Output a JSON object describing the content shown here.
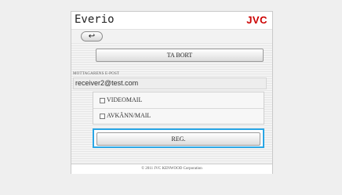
{
  "header": {
    "brand": "Everio",
    "logo": "JVC"
  },
  "nav": {
    "back_icon": "back-arrow-icon",
    "back_glyph": "↩"
  },
  "actions": {
    "delete_label": "TA BORT",
    "register_label": "REG."
  },
  "recipient": {
    "label": "MOTTAGARENS E-POST",
    "email": "receiver2@test.com"
  },
  "options": [
    {
      "label": "VIDEOMAIL",
      "checked": false
    },
    {
      "label": "AVKÄNN/MAIL",
      "checked": false
    }
  ],
  "footer": {
    "copyright": "© 2011 JVC KENWOOD Corporation"
  },
  "colors": {
    "logo": "#cc0000",
    "focus_outline": "#29a6e5"
  }
}
